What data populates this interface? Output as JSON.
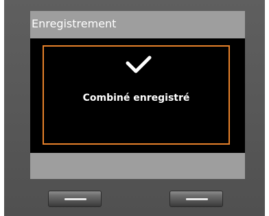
{
  "screen": {
    "title": "Enregistrement",
    "status_icon": "check-icon",
    "status_message": "Combiné enregistré"
  },
  "softkeys": {
    "left_icon": "dash-icon",
    "right_icon": "dash-icon"
  },
  "colors": {
    "device_body": "#575757",
    "title_bar": "#9e9e9e",
    "display_background": "#000000",
    "highlight_border": "#e8822a",
    "text": "#ffffff"
  }
}
